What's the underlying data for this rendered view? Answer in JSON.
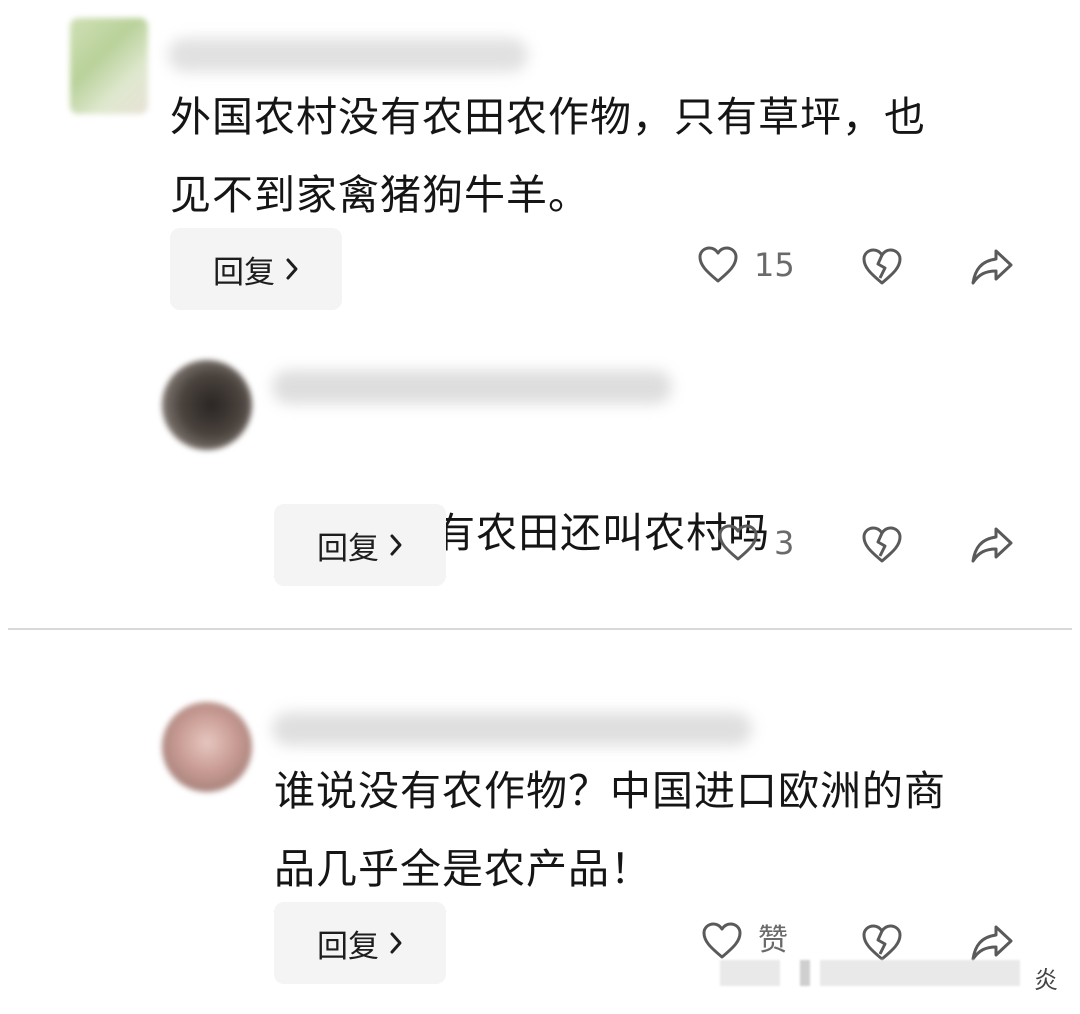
{
  "comments": [
    {
      "text": "外国农村没有农田农作物，只有草坪，也\n见不到家禽猪狗牛羊。",
      "reply_label": "回复",
      "like_count": "15"
    },
    {
      "text": "没有农田还叫农村吗",
      "reply_label": "回复",
      "like_count": "3"
    },
    {
      "text": "谁说没有农作物？中国进口欧洲的商\n品几乎全是农产品！",
      "reply_label": "回复",
      "like_count": "赞"
    }
  ],
  "footer": {
    "tail_char": "炎"
  },
  "icons": {
    "like": "heart-outline-icon",
    "dislike": "broken-heart-icon",
    "share": "share-arrow-icon",
    "reply_chevron": "chevron-right-icon",
    "emoji": "facepalm-crying-emoji"
  },
  "colors": {
    "text": "#151515",
    "muted": "#6a6a6a",
    "button_bg": "#f4f4f4",
    "divider": "#d9d9d9"
  }
}
